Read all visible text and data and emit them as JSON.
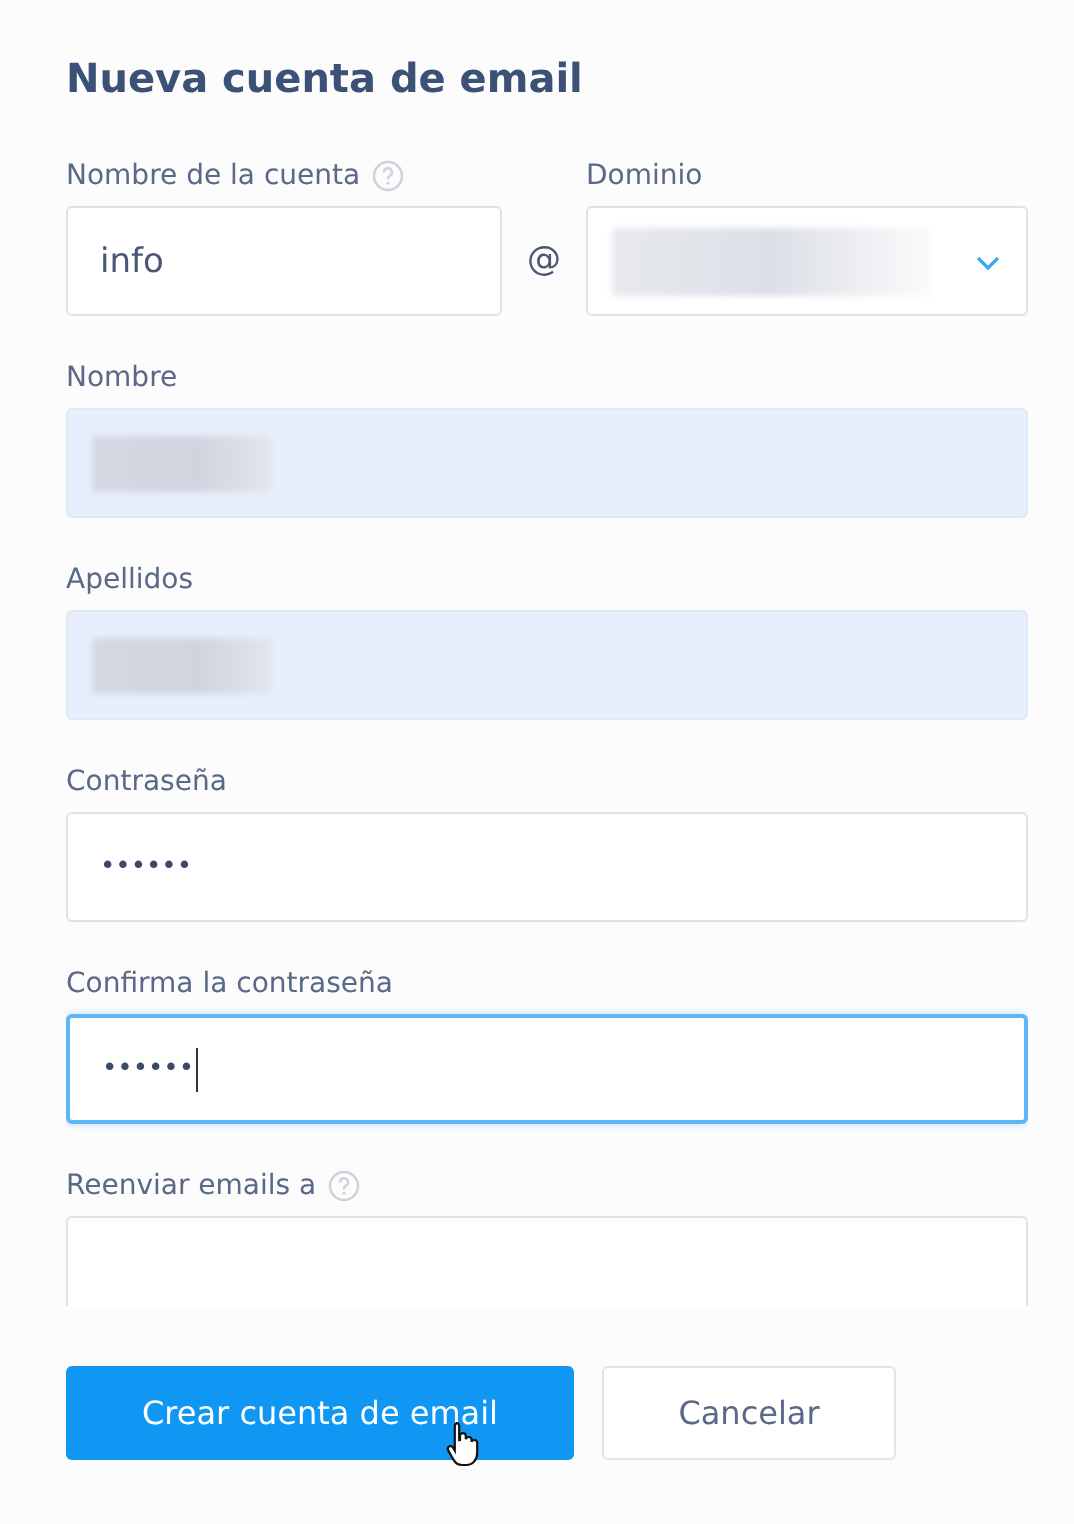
{
  "title": "Nueva cuenta de email",
  "account": {
    "label": "Nombre de la cuenta",
    "help": true,
    "value": "info",
    "separator": "@"
  },
  "domain": {
    "label": "Dominio",
    "redacted": true,
    "expanded": false
  },
  "fields": [
    {
      "label": "Nombre",
      "autofilled": true,
      "redacted": true,
      "focused": false
    },
    {
      "label": "Apellidos",
      "autofilled": true,
      "redacted": true,
      "focused": false
    },
    {
      "label": "Contraseña",
      "autofilled": false,
      "redacted": false,
      "focused": false,
      "value": "••••••"
    },
    {
      "label": "Confirma la contraseña",
      "autofilled": false,
      "redacted": false,
      "focused": true,
      "value": "••••••"
    },
    {
      "label": "Reenviar emails a",
      "help": true,
      "autofilled": false,
      "redacted": false,
      "focused": false
    }
  ],
  "buttons": [
    {
      "label": "Crear cuenta de email",
      "kind": "primary"
    },
    {
      "label": "Cancelar",
      "kind": "secondary"
    }
  ]
}
